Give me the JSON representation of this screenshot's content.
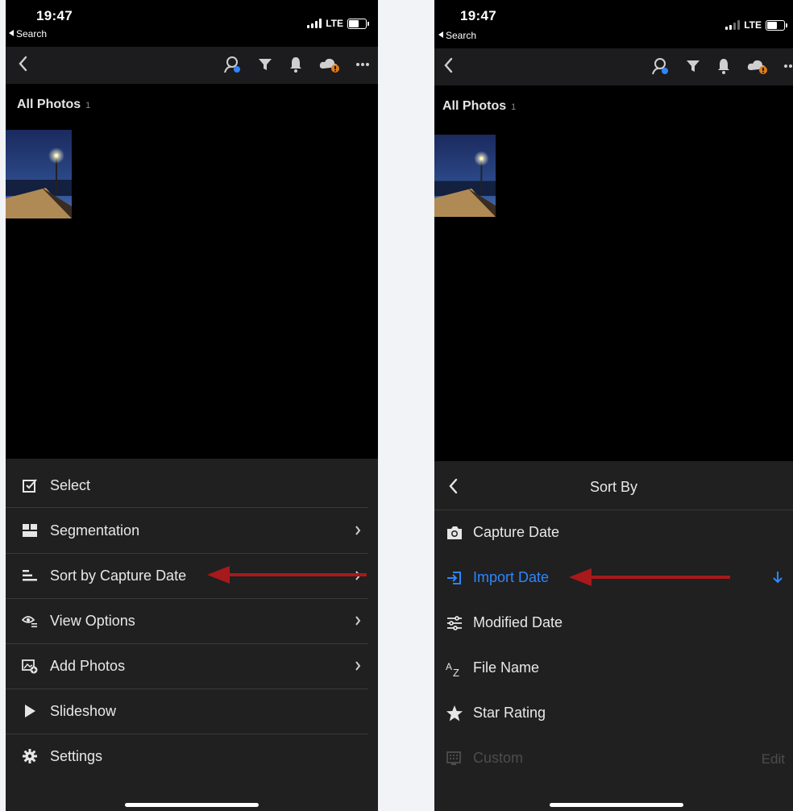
{
  "colors": {
    "background": "#f1f3f6",
    "sheet": "#202020",
    "accent_blue": "#2d86ff",
    "annotation_red": "#a8191c",
    "cloud_badge": "#e07b1a"
  },
  "status_bar": {
    "time": "19:47",
    "back_app": "Search",
    "network": "LTE"
  },
  "icons": {
    "nav": [
      "back-chevron-icon",
      "people-search-icon",
      "filter-icon",
      "bell-icon",
      "cloud-warning-icon",
      "more-icon"
    ]
  },
  "album": {
    "title": "All Photos",
    "count": "1"
  },
  "left_menu": {
    "items": [
      {
        "label": "Select",
        "icon": "select-checkbox-icon"
      },
      {
        "label": "Segmentation",
        "icon": "segmentation-icon"
      },
      {
        "label": "Sort by Capture Date",
        "icon": "sort-icon"
      },
      {
        "label": "View Options",
        "icon": "view-options-icon"
      },
      {
        "label": "Add Photos",
        "icon": "add-photos-icon"
      },
      {
        "label": "Slideshow",
        "icon": "play-icon"
      },
      {
        "label": "Settings",
        "icon": "gear-icon"
      }
    ]
  },
  "sort_by": {
    "title": "Sort By",
    "items": [
      {
        "label": "Capture Date",
        "icon": "camera-icon"
      },
      {
        "label": "Import Date",
        "icon": "import-icon",
        "selected": true,
        "direction": "descending"
      },
      {
        "label": "Modified Date",
        "icon": "sliders-icon"
      },
      {
        "label": "File Name",
        "icon": "az-icon"
      },
      {
        "label": "Star Rating",
        "icon": "star-icon"
      },
      {
        "label": "Custom",
        "icon": "custom-grid-icon",
        "disabled": true
      }
    ],
    "edit_label": "Edit"
  }
}
